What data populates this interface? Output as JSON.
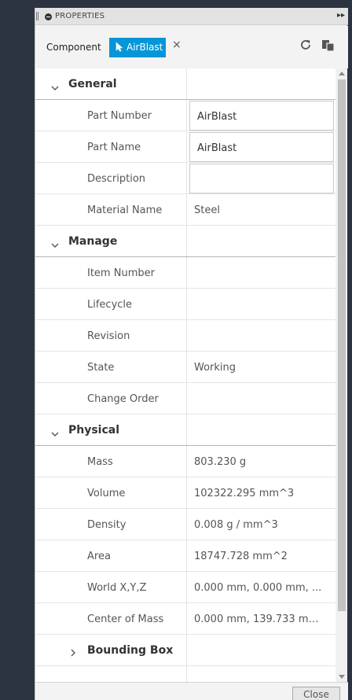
{
  "panel": {
    "title": "PROPERTIES",
    "toolbar": {
      "component_label": "Component",
      "selected_chip": "AirBlast",
      "clear_icon": "×"
    },
    "footer": {
      "close_label": "Close"
    }
  },
  "groups": {
    "general": {
      "name": "General",
      "part_number": {
        "label": "Part Number",
        "value": "AirBlast"
      },
      "part_name": {
        "label": "Part Name",
        "value": "AirBlast"
      },
      "description": {
        "label": "Description",
        "value": ""
      },
      "material_name": {
        "label": "Material Name",
        "value": "Steel"
      }
    },
    "manage": {
      "name": "Manage",
      "item_number": {
        "label": "Item Number",
        "value": ""
      },
      "lifecycle": {
        "label": "Lifecycle",
        "value": ""
      },
      "revision": {
        "label": "Revision",
        "value": ""
      },
      "state": {
        "label": "State",
        "value": "Working"
      },
      "change_order": {
        "label": "Change Order",
        "value": ""
      }
    },
    "physical": {
      "name": "Physical",
      "mass": {
        "label": "Mass",
        "value": "803.230 g"
      },
      "volume": {
        "label": "Volume",
        "value": "102322.295 mm^3"
      },
      "density": {
        "label": "Density",
        "value": "0.008 g / mm^3"
      },
      "area": {
        "label": "Area",
        "value": "18747.728 mm^2"
      },
      "world_xyz": {
        "label": "World X,Y,Z",
        "value": "0.000 mm, 0.000 mm, ..."
      },
      "center_of_mass": {
        "label": "Center of Mass",
        "value": "0.000 mm, 139.733 mm..."
      },
      "bounding_box": {
        "label": "Bounding Box"
      }
    }
  },
  "icons": {
    "collapse": "collapse-icon",
    "expand_panel": "double-chevron-right-icon",
    "selection_cursor": "cursor-icon",
    "refresh": "refresh-icon",
    "copy": "copy-icon",
    "group_expanded": "chevron-down-icon",
    "group_collapsed": "chevron-right-icon"
  },
  "colors": {
    "accent_chip": "#0696d7",
    "background_dark": "#2b3440"
  }
}
